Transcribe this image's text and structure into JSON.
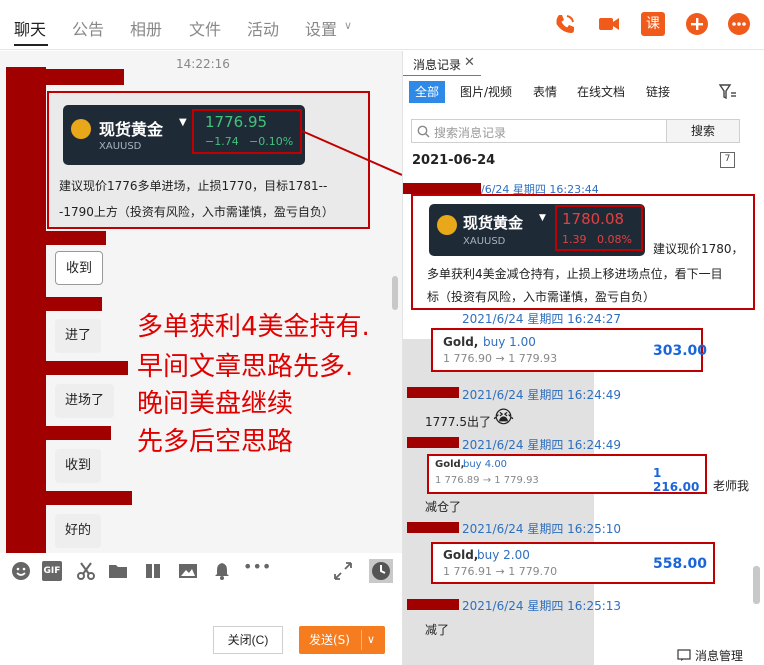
{
  "tabs": {
    "chat": "聊天",
    "notice": "公告",
    "album": "相册",
    "files": "文件",
    "activity": "活动",
    "settings": "设置"
  },
  "top_icons": [
    "phone-icon",
    "video-icon",
    "course-icon",
    "add-icon",
    "more-icon"
  ],
  "course_icon_label": "课",
  "chat": {
    "time_label": "14:22:16",
    "quote_card": {
      "name": "现货黄金",
      "symbol": "XAUUSD",
      "price": "1776.95",
      "change": "−1.74",
      "change_pct": "−0.10%"
    },
    "message": "建议现价1776多单进场，止损1770，目标1781---1790上方（投资有风险，入市需谨慎，盈亏自负）",
    "bubbles": [
      "收到",
      "进了",
      "进场了",
      "收到",
      "好的"
    ],
    "overlay_lines": [
      "多单获利4美金持有.",
      "早间文章思路先多.",
      "晚间美盘继续",
      "先多后空思路"
    ]
  },
  "toolbar": {
    "icons": [
      "emoji-icon",
      "gif-icon",
      "scissors-icon",
      "folder-icon",
      "shake-icon",
      "image-icon",
      "bell-icon",
      "more-dots-icon"
    ],
    "gif_label": "GIF",
    "close_label": "关闭(C)",
    "send_label": "发送(S)"
  },
  "right_panel": {
    "title": "消息记录",
    "filters": [
      "全部",
      "图片/视频",
      "表情",
      "在线文档",
      "链接"
    ],
    "search_placeholder": "搜索消息记录",
    "search_button": "搜索",
    "date": "2021-06-24",
    "calendar_label": "7",
    "entries": [
      {
        "stamp": "/6/24 星期四 16:23:44",
        "quote": {
          "name": "现货黄金",
          "symbol": "XAUUSD",
          "price": "1780.08",
          "change": "1.39",
          "change_pct": "0.08%"
        },
        "text_tail": "建议现价1780，",
        "text_lines": [
          "多单获利4美金减仓持有，止损上移进场点位，看下一目",
          "标（投资有风险，入市需谨慎，盈亏自负）"
        ]
      },
      {
        "stamp": "2021/6/24 星期四 16:24:27",
        "trade": {
          "gold": "Gold,",
          "buy": "buy 1.00",
          "prices": "1 776.90 → 1 779.93",
          "profit": "303.00"
        }
      },
      {
        "stamp": "2021/6/24 星期四 16:24:49",
        "text": "1777.5出了"
      },
      {
        "stamp": "2021/6/24 星期四 16:24:49",
        "trade": {
          "gold": "Gold,",
          "buy": "buy 4.00",
          "prices": "1 776.89 → 1 779.93",
          "profit": "1 216.00"
        },
        "side_text": "老师我"
      },
      {
        "text": "减仓了"
      },
      {
        "stamp": "2021/6/24 星期四 16:25:10",
        "trade": {
          "gold": "Gold,",
          "buy": "buy 2.00",
          "prices": "1 776.91 → 1 779.70",
          "profit": "558.00"
        }
      },
      {
        "stamp": "2021/6/24 星期四 16:25:13",
        "text": "减了"
      }
    ],
    "footer": "消息管理"
  },
  "colors": {
    "accent_orange": "#f57c1f",
    "annotation_red": "#c00000",
    "link_blue": "#2e6fbf",
    "profit_blue": "#1a66d9",
    "quote_green": "#3fc47a",
    "quote_red": "#e24040"
  }
}
